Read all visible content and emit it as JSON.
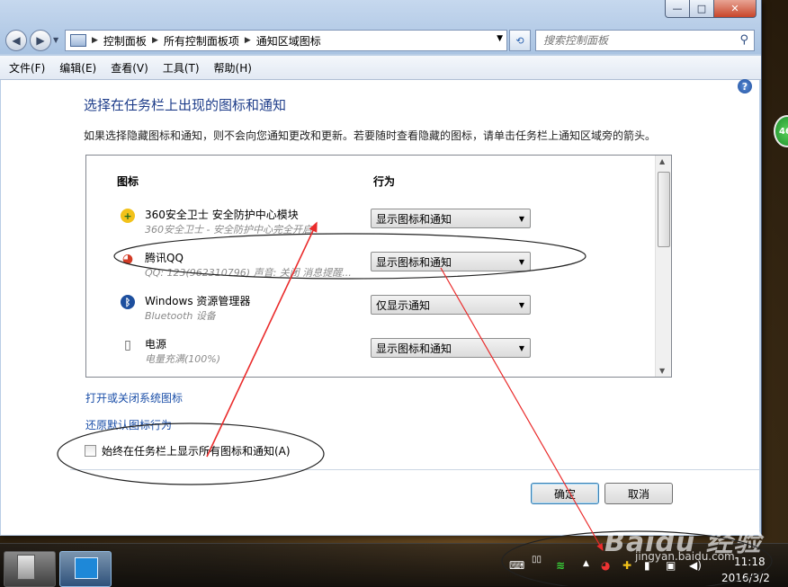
{
  "window": {
    "min_glyph": "—",
    "max_glyph": "□",
    "close_glyph": "✕"
  },
  "nav": {
    "back_glyph": "◀",
    "fwd_glyph": "▶",
    "drop_glyph": "▼"
  },
  "address": {
    "crumbs": [
      "控制面板",
      "所有控制面板项",
      "通知区域图标"
    ],
    "sep": "▶",
    "dropdown_glyph": "▼",
    "refresh_glyph": "⟲"
  },
  "search": {
    "placeholder": "搜索控制面板",
    "icon": "search-icon"
  },
  "menu": [
    "文件(F)",
    "编辑(E)",
    "查看(V)",
    "工具(T)",
    "帮助(H)"
  ],
  "help": "?",
  "page": {
    "title": "选择在任务栏上出现的图标和通知",
    "description": "如果选择隐藏图标和通知，则不会向您通知更改和更新。若要随时查看隐藏的图标，请单击任务栏上通知区域旁的箭头。"
  },
  "table": {
    "col_icon": "图标",
    "col_behavior": "行为",
    "rows": [
      {
        "icon": "360-shield-icon",
        "glyph": "+",
        "color": "#f2c21a",
        "name": "360安全卫士 安全防护中心模块",
        "desc": "360安全卫士 - 安全防护中心完全开启",
        "behavior": "显示图标和通知"
      },
      {
        "icon": "qq-penguin-icon",
        "glyph": "◕",
        "color": "#d23b26",
        "name": "腾讯QQ",
        "desc": "QQ: 123(962310796)  声音: 关闭  消息提醒...",
        "behavior": "显示图标和通知"
      },
      {
        "icon": "bluetooth-icon",
        "glyph": "ᛒ",
        "color": "#1d4f9e",
        "name": "Windows 资源管理器",
        "desc": "Bluetooth 设备",
        "behavior": "仅显示通知"
      },
      {
        "icon": "power-plug-icon",
        "glyph": "▯",
        "color": "#555555",
        "name": "电源",
        "desc": "电量充满(100%)",
        "behavior": "显示图标和通知"
      }
    ]
  },
  "links": {
    "system_icons": "打开或关闭系统图标",
    "restore": "还原默认图标行为"
  },
  "always_show": {
    "label": "始终在任务栏上显示所有图标和通知(A)",
    "checked": false
  },
  "buttons": {
    "ok": "确定",
    "cancel": "取消"
  },
  "taskbar": {
    "time": "11:18",
    "date": "2016/3/2"
  },
  "side_badge": "46",
  "watermark": {
    "brand": "Baidu 经验",
    "url": "jingyan.baidu.com"
  }
}
